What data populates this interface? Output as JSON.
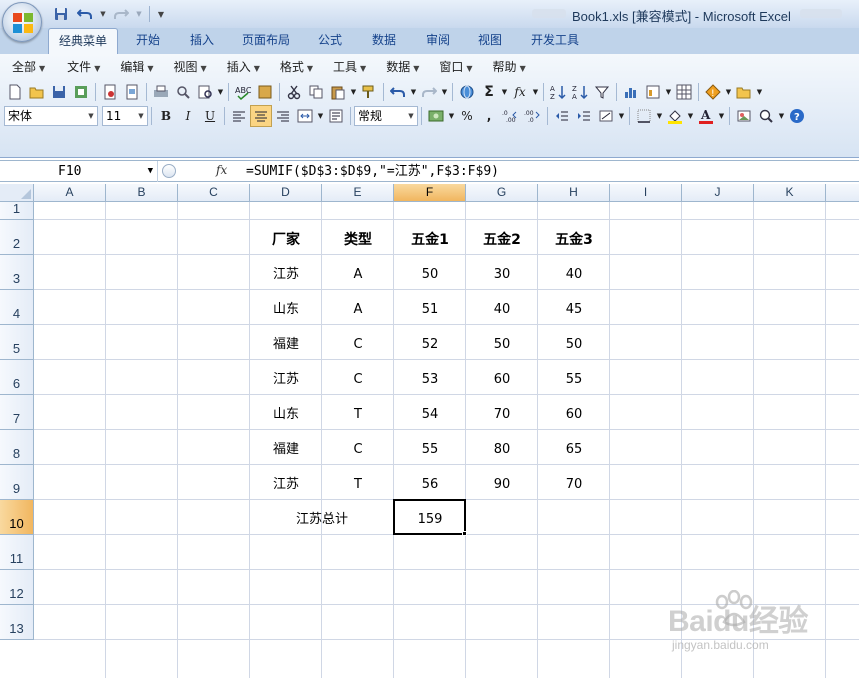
{
  "window": {
    "title": "Book1.xls  [兼容模式] - Microsoft Excel"
  },
  "ribbon_tabs": [
    {
      "label": "经典菜单",
      "active": true
    },
    {
      "label": "开始"
    },
    {
      "label": "插入"
    },
    {
      "label": "页面布局"
    },
    {
      "label": "公式"
    },
    {
      "label": "数据"
    },
    {
      "label": "审阅"
    },
    {
      "label": "视图"
    },
    {
      "label": "开发工具"
    }
  ],
  "classic_menu": [
    "全部",
    "文件",
    "编辑",
    "视图",
    "插入",
    "格式",
    "工具",
    "数据",
    "窗口",
    "帮助"
  ],
  "format_toolbar": {
    "font_name": "宋体",
    "font_size": "11",
    "bold": "B",
    "italic": "I",
    "underline": "U",
    "number_format": "常规",
    "percent": "%",
    "comma": ",",
    "sigma": "Σ",
    "fx": "fx"
  },
  "formula_bar": {
    "name_box": "F10",
    "fx_label": "fx",
    "formula": "=SUMIF($D$3:$D$9,\"=江苏\",F$3:F$9)"
  },
  "sheet": {
    "columns": [
      "A",
      "B",
      "C",
      "D",
      "E",
      "F",
      "G",
      "H",
      "I",
      "J",
      "K"
    ],
    "rows": [
      "1",
      "2",
      "3",
      "4",
      "5",
      "6",
      "7",
      "8",
      "9",
      "10",
      "11",
      "12",
      "13"
    ],
    "selected_column": "F",
    "selected_row": "10",
    "table_headers": [
      "厂家",
      "类型",
      "五金1",
      "五金2",
      "五金3"
    ],
    "table_rows": [
      [
        "江苏",
        "A",
        "50",
        "30",
        "40"
      ],
      [
        "山东",
        "A",
        "51",
        "40",
        "45"
      ],
      [
        "福建",
        "C",
        "52",
        "50",
        "50"
      ],
      [
        "江苏",
        "C",
        "53",
        "60",
        "55"
      ],
      [
        "山东",
        "T",
        "54",
        "70",
        "60"
      ],
      [
        "福建",
        "C",
        "55",
        "80",
        "65"
      ],
      [
        "江苏",
        "T",
        "56",
        "90",
        "70"
      ]
    ],
    "total_label": "江苏总计",
    "total_value": "159"
  },
  "watermark": {
    "brand": "Baidu经验",
    "url": "jingyan.baidu.com"
  },
  "colors": {
    "selection_header": "#f1b65f",
    "ribbon_blue": "#bfd3ea",
    "grid_line": "#d0d7e5"
  }
}
